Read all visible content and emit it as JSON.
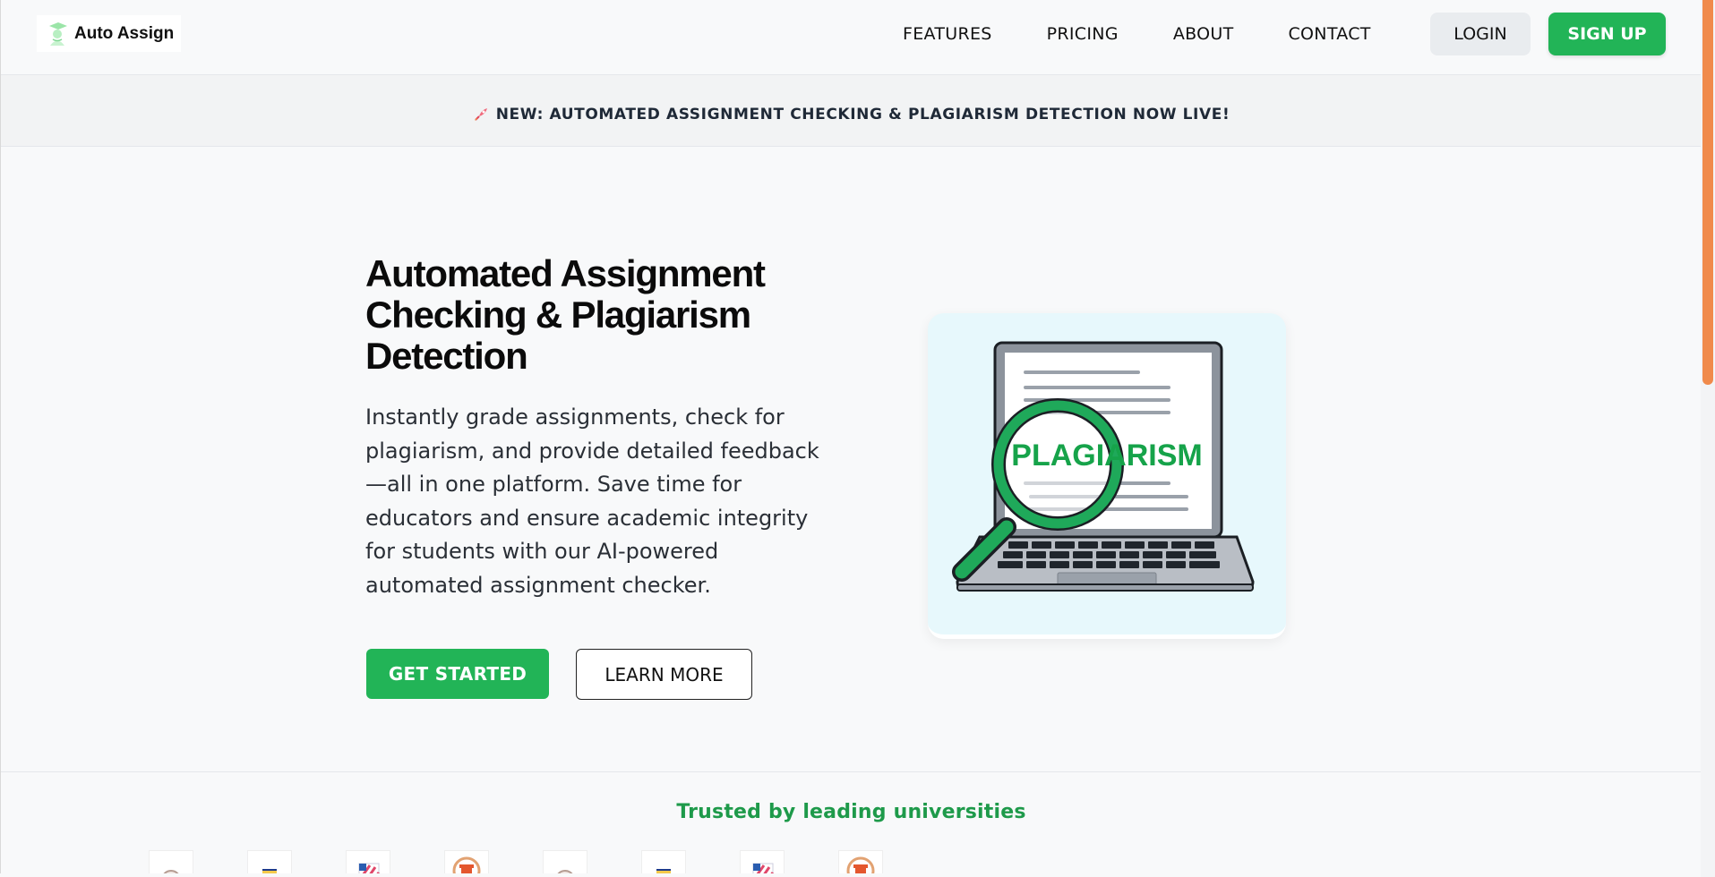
{
  "brand": {
    "name": "Auto Assign",
    "accent": "#22b457",
    "scroll_accent": "#f08a4b"
  },
  "nav": {
    "links": [
      "FEATURES",
      "PRICING",
      "ABOUT",
      "CONTACT"
    ],
    "login": "LOGIN",
    "signup": "SIGN UP"
  },
  "announcement": {
    "icon": "rocket-icon",
    "text": "NEW: AUTOMATED ASSIGNMENT CHECKING & PLAGIARISM DETECTION NOW LIVE!"
  },
  "hero": {
    "title": "Automated Assignment Checking & Plagiarism Detection",
    "description": "Instantly grade assignments, check for plagiarism, and provide detailed feedback—all in one platform. Save time for educators and ensure academic integrity for students with our AI-powered automated assignment checker.",
    "primary_cta": "GET STARTED",
    "secondary_cta": "LEARN MORE",
    "illustration_label": "PLAGIARISM"
  },
  "trusted": {
    "title": "Trusted by leading universities",
    "logos": [
      "university-seal-icon",
      "shield-crest-icon",
      "striped-flag-icon",
      "column-emblem-icon",
      "university-seal-icon",
      "shield-crest-icon",
      "striped-flag-icon",
      "column-emblem-icon"
    ]
  }
}
